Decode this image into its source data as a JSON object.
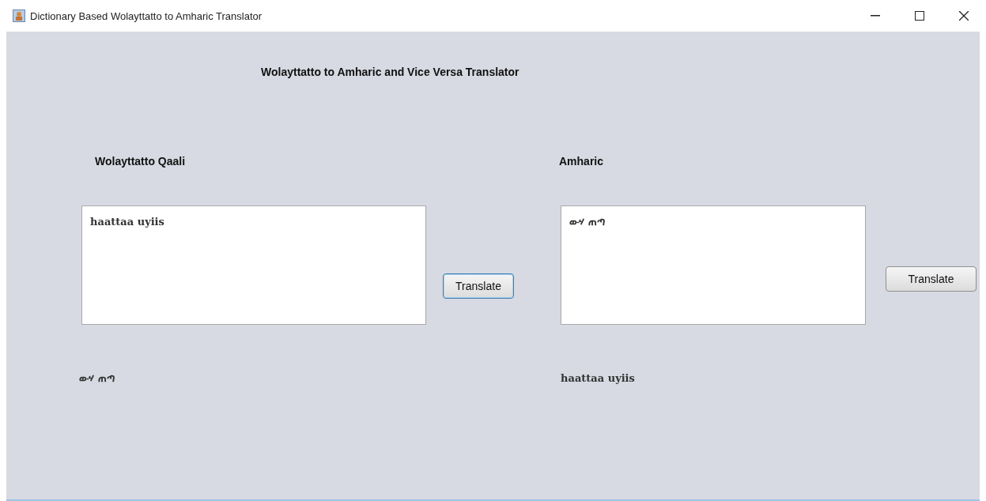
{
  "window": {
    "title": "Dictionary Based Wolayttatto to Amharic Translator"
  },
  "heading": "Wolayttatto to Amharic and Vice Versa Translator",
  "panels": [
    {
      "label": "Wolayttatto Qaali",
      "input_text": "haattaa uyiis",
      "button": {
        "label": "Translate",
        "focused": true
      },
      "output_text": "ውሃ ጠጣ"
    },
    {
      "label": "Amharic",
      "input_text": "ውሃ ጠጣ",
      "button": {
        "label": "Translate",
        "focused": false
      },
      "output_text": "haattaa uyiis"
    }
  ]
}
